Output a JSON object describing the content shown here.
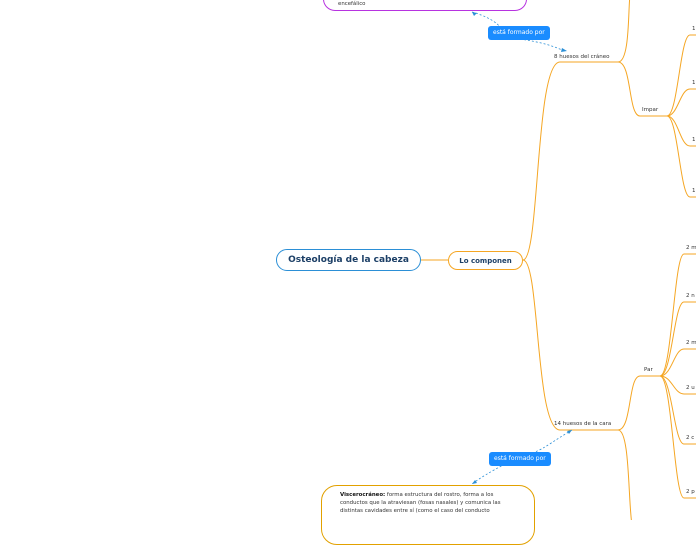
{
  "root": {
    "label": "Osteología de la cabeza"
  },
  "main": {
    "label": "Lo componen"
  },
  "craneo": {
    "label": "8 huesos del cráneo",
    "link_label": "está formado por"
  },
  "cara": {
    "label": "14 huesos de la cara",
    "link_label": "está formado por"
  },
  "impar": {
    "label": "Impar",
    "children": [
      "1",
      "1",
      "1",
      "1"
    ]
  },
  "par": {
    "label": "Par",
    "children": [
      "2 m",
      "2 n",
      "2 m",
      "2 u",
      "2 c",
      "2 p"
    ]
  },
  "top_callout": {
    "text": "encefálico"
  },
  "bottom_callout": {
    "title": "Viscerocráneo:",
    "line1": "forma estructura del rostro, forma a los",
    "line2": "conductos que la atraviesan (fosas nasales) y comunica las",
    "line3": "distintas cavidades entre sí (como el caso del conducto"
  },
  "colors": {
    "root_border": "#2b8fd6",
    "branch": "#f5a623",
    "link": "#1a8cff",
    "callout_top": "#b733e0",
    "callout_bottom": "#e2a100"
  }
}
